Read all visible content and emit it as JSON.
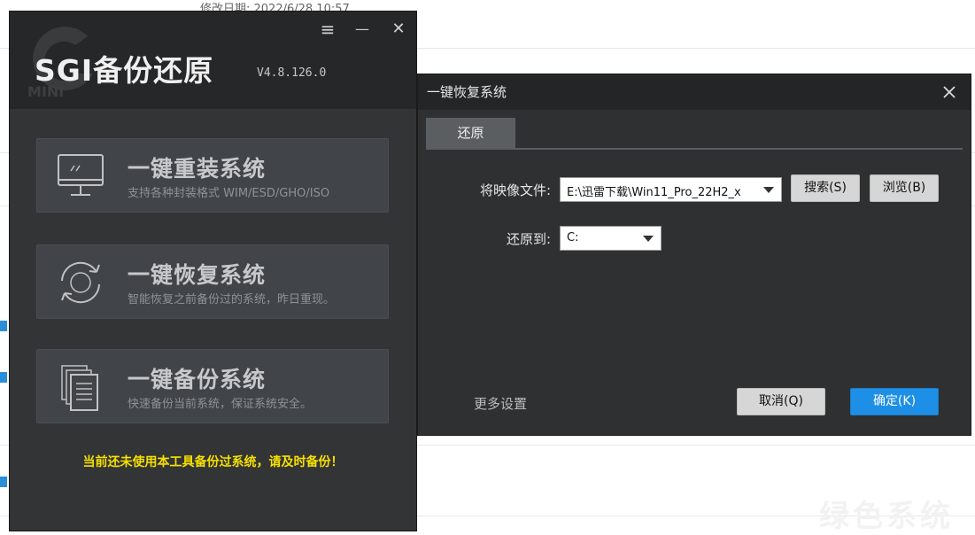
{
  "background": {
    "top_text": "修改日期: 2022/6/28 10:57",
    "watermark": "绿色系统"
  },
  "main_window": {
    "title": "SGI备份还原",
    "version": "V4.8.126.0",
    "logo_sub": "MINI",
    "controls": {
      "menu": "≡",
      "minimize": "—",
      "close": "✕"
    },
    "cards": [
      {
        "title": "一键重装系统",
        "subtitle": "支持各种封装格式 WIM/ESD/GHO/ISO",
        "icon": "monitor-icon"
      },
      {
        "title": "一键恢复系统",
        "subtitle": "智能恢复之前备份过的系统，昨日重现。",
        "icon": "refresh-cycle-icon"
      },
      {
        "title": "一键备份系统",
        "subtitle": "快速备份当前系统，保证系统安全。",
        "icon": "stacked-documents-icon"
      }
    ],
    "notice": "当前还未使用本工具备份过系统，请及时备份！",
    "colors": {
      "notice": "#f5e000",
      "background": "#333436"
    }
  },
  "dialog": {
    "title": "一键恢复系统",
    "tab_label": "还原",
    "image_label": "将映像文件:",
    "image_value": "E:\\迅雷下载\\Win11_Pro_22H2_x",
    "search_label": "搜索(S)",
    "browse_label": "浏览(B)",
    "restore_to_label": "还原到:",
    "restore_to_value": "C:",
    "more_settings": "更多设置",
    "cancel_label": "取消(Q)",
    "confirm_label": "确定(K)",
    "colors": {
      "confirm": "#1e8fe6"
    }
  }
}
